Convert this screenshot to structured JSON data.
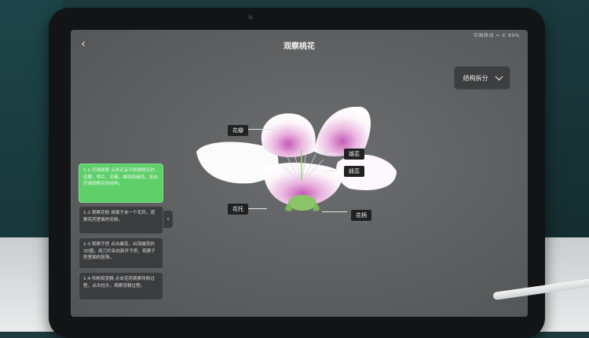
{
  "app": {
    "title": "观察桃花",
    "back_icon": "chevron-left-icon",
    "status": "中国移动 ≈ ✆ 89%"
  },
  "dropdown": {
    "label": "结构拆分",
    "icon": "chevron-down-icon"
  },
  "flower_labels": {
    "petal": "花瓣",
    "stamen": "雄蕊",
    "pistil": "雌蕊",
    "receptacle": "花托",
    "pedicel": "花柄"
  },
  "steps": [
    {
      "text": "1-1 仔细观察  点击花朵可观察桃花的花瓣、萼片、花瓣、雄蕊和雌蕊，各自仔细观察花的结构。",
      "active": true
    },
    {
      "text": "1-2 观察花粉  用镊子夹一个花药，观察花药里面的花粉。",
      "active": false
    },
    {
      "text": "1-3 观察子房  点击雌蕊，出现雌蕊的3D图，用刀片纵向剖开子房，观察子房里面的胚珠。",
      "active": false
    },
    {
      "text": "1-4 传粉和受精  点击花药观察传粉过程，点击柱头，观察受精过程。",
      "active": false
    }
  ],
  "panel_toggle_icon": "chevron-left-icon",
  "colors": {
    "active_step": "#5fcf6a",
    "screen_bg": "#5d5f61",
    "label_bg": "#1f2123"
  }
}
